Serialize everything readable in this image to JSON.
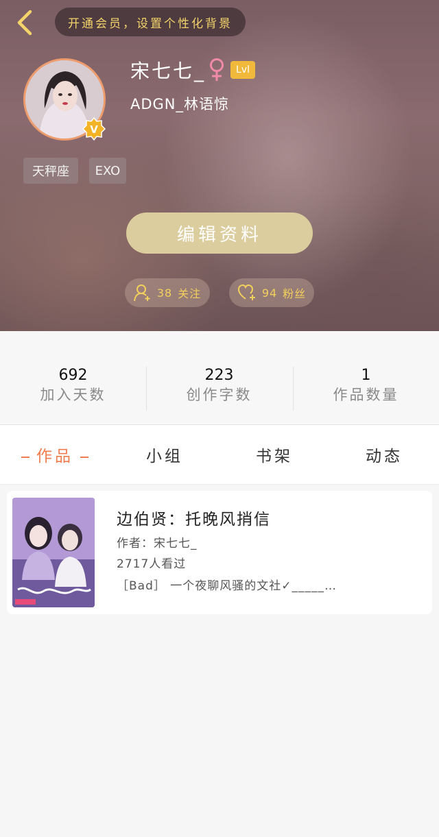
{
  "header": {
    "vip_banner": "开通会员，设置个性化背景",
    "username": "宋七七_",
    "level_badge": "Lvl",
    "subtitle": "ADGN_林语惊",
    "tags": [
      "天秤座",
      "EXO"
    ],
    "edit_button": "编辑资料",
    "follow": {
      "count": "38",
      "label": "关注"
    },
    "fans": {
      "count": "94",
      "label": "粉丝"
    },
    "avatar_badge": "V",
    "accent_color": "#f3d36a"
  },
  "stats": [
    {
      "value": "692",
      "label": "加入天数"
    },
    {
      "value": "223",
      "label": "创作字数"
    },
    {
      "value": "1",
      "label": "作品数量"
    }
  ],
  "tabs": [
    {
      "label": "作品",
      "active": true
    },
    {
      "label": "小组",
      "active": false
    },
    {
      "label": "书架",
      "active": false
    },
    {
      "label": "动态",
      "active": false
    }
  ],
  "works": [
    {
      "title": "边伯贤：托晚风捎信",
      "author": "作者：宋七七_",
      "views": "2717人看过",
      "description": "［Bad］ 一个夜聊风骚的文社✓_____…"
    }
  ],
  "colors": {
    "active_tab": "#f07c4e",
    "edit_button_bg": "#dccd9f",
    "level_badge_bg": "#f0b93c",
    "avatar_border": "#ef9c6c"
  }
}
